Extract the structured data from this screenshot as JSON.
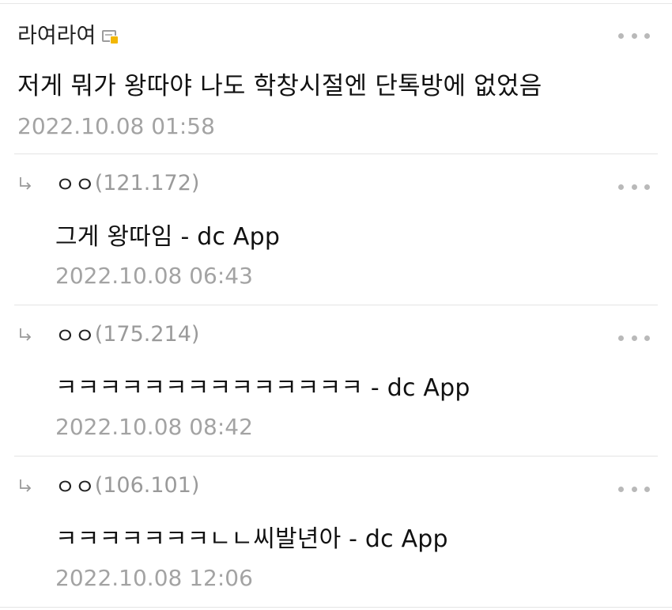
{
  "comments": [
    {
      "author": "라여라여",
      "ip": "",
      "content": "저게 뭐가 왕따야 나도 학창시절엔 단톡방에 없었음",
      "timestamp": "2022.10.08 01:58"
    }
  ],
  "replies": [
    {
      "author": "ㅇㅇ",
      "ip": "(121.172)",
      "content": "그게 왕따임 - dc App",
      "timestamp": "2022.10.08 06:43"
    },
    {
      "author": "ㅇㅇ",
      "ip": "(175.214)",
      "content": "ㅋㅋㅋㅋㅋㅋㅋㅋㅋㅋㅋㅋㅋㅋ - dc App",
      "timestamp": "2022.10.08 08:42"
    },
    {
      "author": "ㅇㅇ",
      "ip": "(106.101)",
      "content": "ㅋㅋㅋㅋㅋㅋㅋㄴㄴ씨발년아 - dc App",
      "timestamp": "2022.10.08 12:06"
    }
  ],
  "icons": {
    "badge": "gallery-badge-icon",
    "reply": "reply-arrow-icon",
    "more": "more-options-icon"
  },
  "colors": {
    "badge_accent": "#f2b705",
    "meta_text": "#a3a3a3"
  }
}
